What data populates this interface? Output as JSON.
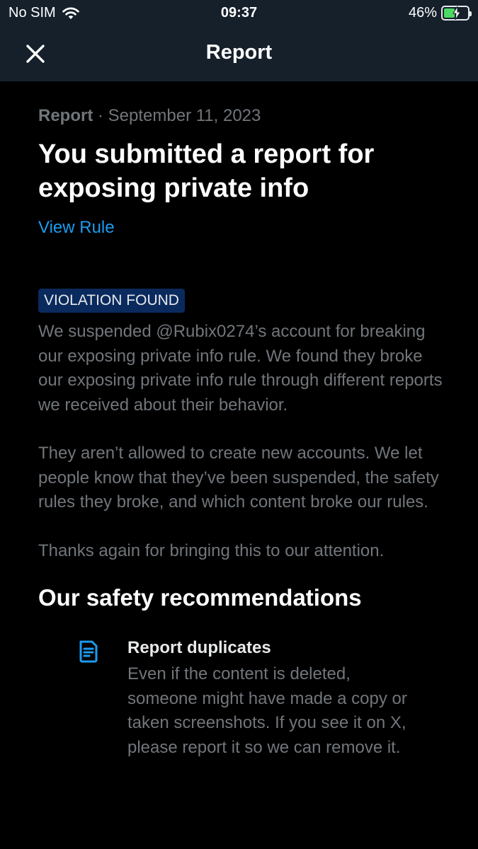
{
  "status_bar": {
    "carrier": "No SIM",
    "time": "09:37",
    "battery": "46%",
    "battery_level": 0.46
  },
  "nav": {
    "title": "Report",
    "close_icon": "close-icon"
  },
  "report": {
    "meta_label": "Report",
    "meta_sep": " · ",
    "date": "September 11, 2023",
    "headline": "You submitted a report for exposing private info",
    "view_rule": "View Rule",
    "badge": "VIOLATION FOUND",
    "paragraphs": [
      "We suspended @Rubix0274’s account for breaking our exposing private info rule. We found they broke our exposing private info rule through different reports we received about their behavior.",
      "They aren’t allowed to create new accounts. We let people know that they’ve been suspended, the safety rules they broke, and which content broke our rules.",
      "Thanks again for bringing this to our attention."
    ]
  },
  "recommendations": {
    "title": "Our safety recommendations",
    "items": [
      {
        "icon": "document-icon",
        "title": "Report duplicates",
        "text": "Even if the content is deleted, someone might have made a copy or taken screenshots. If you see it on X, please report it so we can remove it."
      }
    ]
  },
  "colors": {
    "accent": "#1d9bf0",
    "header_bg": "#15202b",
    "badge_bg": "#0a2a5e",
    "muted_text": "#71767b",
    "battery_green": "#4cd964"
  }
}
